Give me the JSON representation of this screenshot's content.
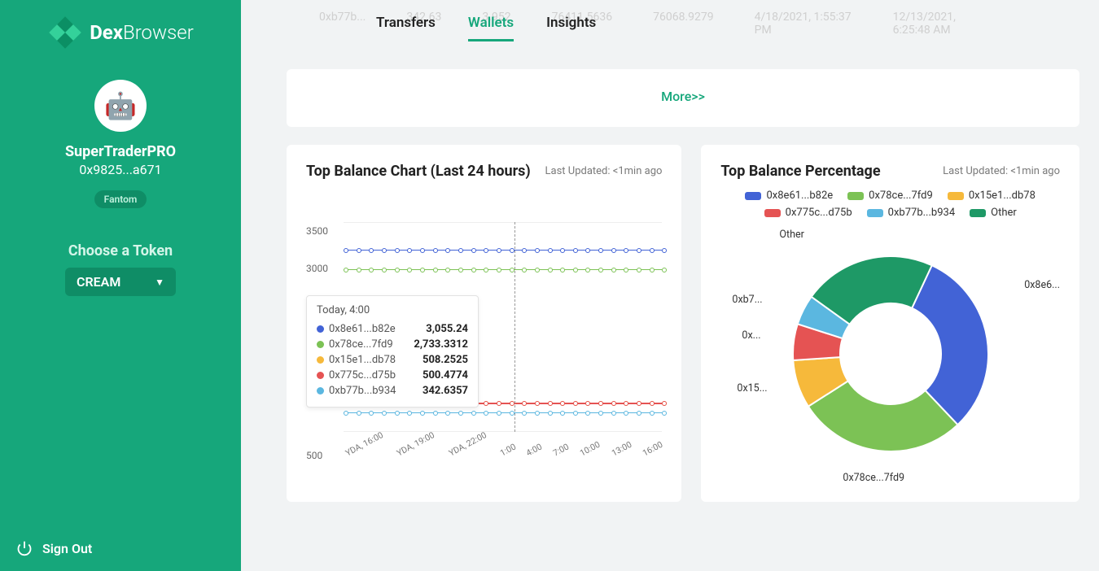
{
  "brand": {
    "bold": "Dex",
    "light": "Browser"
  },
  "profile": {
    "username": "SuperTraderPRO",
    "address": "0x9825...a671",
    "chain": "Fantom"
  },
  "choose": {
    "label": "Choose a Token",
    "token": "CREAM"
  },
  "signout": "Sign Out",
  "tabs": {
    "transfers": "Transfers",
    "wallets": "Wallets",
    "insights": "Insights"
  },
  "faded": [
    "0xb77b...",
    "342.63",
    "3.952",
    "76411.5636",
    "76068.9279",
    "4/18/2021, 1:55:37 PM",
    "12/13/2021, 6:25:48 AM"
  ],
  "more": "More>>",
  "card1": {
    "title": "Top Balance Chart (Last 24 hours)",
    "updated": "Last Updated: <1min ago"
  },
  "card2": {
    "title": "Top Balance Percentage",
    "updated": "Last Updated: <1min ago"
  },
  "tooltip": {
    "title": "Today, 4:00",
    "rows": [
      {
        "name": "0x8e61...b82e",
        "val": "3,055.24",
        "color": "#4263d6"
      },
      {
        "name": "0x78ce...7fd9",
        "val": "2,733.3312",
        "color": "#7cc255"
      },
      {
        "name": "0x15e1...db78",
        "val": "508.2525",
        "color": "#f6b93b"
      },
      {
        "name": "0x775c...d75b",
        "val": "500.4774",
        "color": "#e55353"
      },
      {
        "name": "0xb77b...b934",
        "val": "342.6357",
        "color": "#5bb7e0"
      }
    ]
  },
  "legend": [
    {
      "name": "0x8e61...b82e",
      "color": "#4263d6"
    },
    {
      "name": "0x78ce...7fd9",
      "color": "#7cc255"
    },
    {
      "name": "0x15e1...db78",
      "color": "#f6b93b"
    },
    {
      "name": "0x775c...d75b",
      "color": "#e55353"
    },
    {
      "name": "0xb77b...b934",
      "color": "#5bb7e0"
    },
    {
      "name": "Other",
      "color": "#1e9966"
    }
  ],
  "slice_labels": {
    "other": "Other",
    "s1": "0x8e6...",
    "s2": "0x78ce...7fd9",
    "s3": "0x15...",
    "s4": "0x...",
    "s5": "0xb7..."
  },
  "chart_data": [
    {
      "type": "line",
      "title": "Top Balance Chart (Last 24 hours)",
      "ylabel": "",
      "xlabel": "",
      "ylim": [
        0,
        3500
      ],
      "y_ticks": [
        3500,
        3000,
        500
      ],
      "x": [
        "YDA, 16:00",
        "YDA, 19:00",
        "YDA, 22:00",
        "1:00",
        "4:00",
        "7:00",
        "10:00",
        "13:00",
        "16:00"
      ],
      "series": [
        {
          "name": "0x8e61...b82e",
          "color": "#4263d6",
          "value": 3055.24
        },
        {
          "name": "0x78ce...7fd9",
          "color": "#7cc255",
          "value": 2733.3312
        },
        {
          "name": "0x15e1...db78",
          "color": "#f6b93b",
          "value": 508.2525
        },
        {
          "name": "0x775c...d75b",
          "color": "#e55353",
          "value": 500.4774
        },
        {
          "name": "0xb77b...b934",
          "color": "#5bb7e0",
          "value": 342.6357
        }
      ],
      "note": "All series are flat at their single value across all x categories"
    },
    {
      "type": "pie",
      "title": "Top Balance Percentage",
      "series": [
        {
          "name": "0x8e61...b82e",
          "color": "#4263d6",
          "pct": 31
        },
        {
          "name": "0x78ce...7fd9",
          "color": "#7cc255",
          "pct": 28
        },
        {
          "name": "0x15e1...db78",
          "color": "#f6b93b",
          "pct": 8
        },
        {
          "name": "0x775c...d75b",
          "color": "#e55353",
          "pct": 6
        },
        {
          "name": "0xb77b...b934",
          "color": "#5bb7e0",
          "pct": 5
        },
        {
          "name": "Other",
          "color": "#1e9966",
          "pct": 22
        }
      ]
    }
  ]
}
